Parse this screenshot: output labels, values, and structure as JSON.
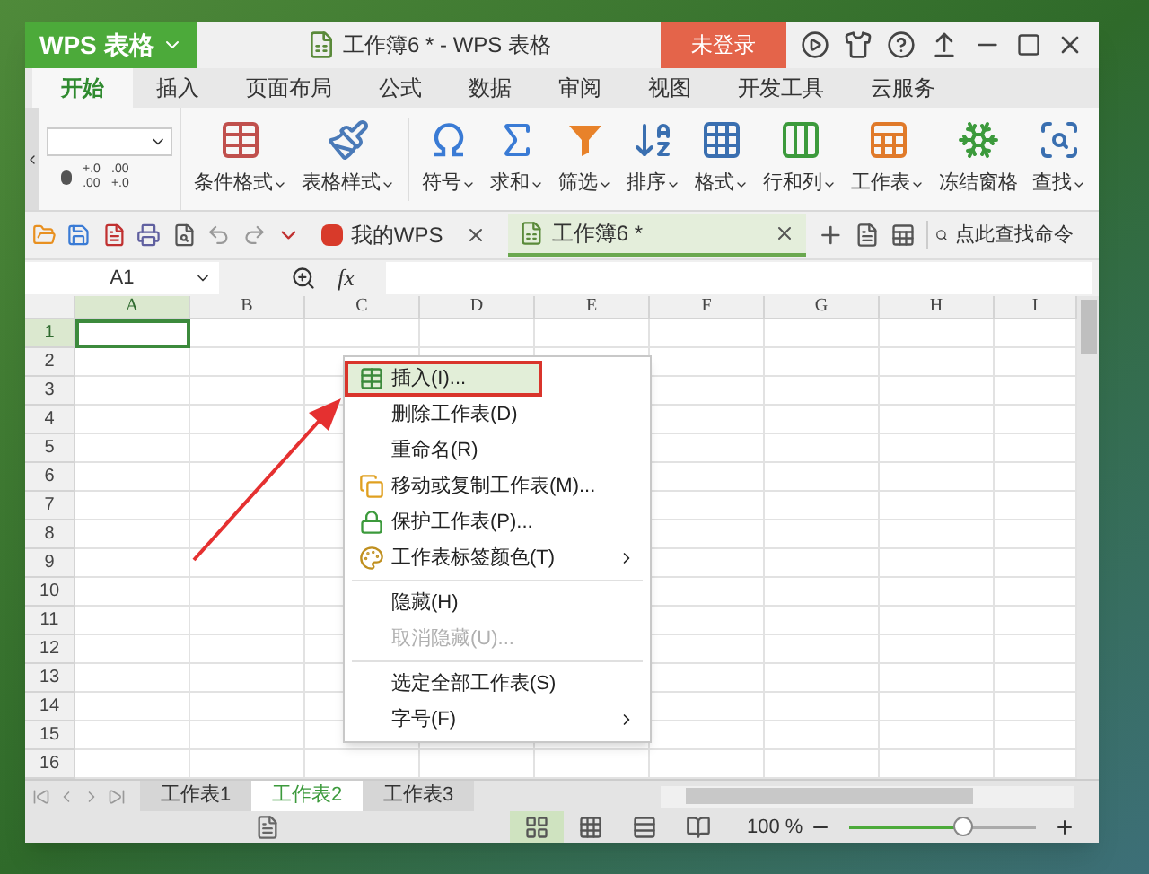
{
  "app_button": {
    "label": "WPS 表格"
  },
  "window": {
    "title": "工作簿6 * - WPS 表格"
  },
  "login_button": {
    "label": "未登录"
  },
  "ribbon_tabs": [
    {
      "label": "开始",
      "selected": true
    },
    {
      "label": "插入",
      "selected": false
    },
    {
      "label": "页面布局",
      "selected": false
    },
    {
      "label": "公式",
      "selected": false
    },
    {
      "label": "数据",
      "selected": false
    },
    {
      "label": "审阅",
      "selected": false
    },
    {
      "label": "视图",
      "selected": false
    },
    {
      "label": "开发工具",
      "selected": false
    },
    {
      "label": "云服务",
      "selected": false
    }
  ],
  "number_format": {
    "decimal_buttons": [
      {
        "lines": [
          "+.0",
          ".00"
        ]
      },
      {
        "lines": [
          ".00",
          "+.0"
        ]
      }
    ]
  },
  "ribbon_buttons": [
    {
      "kind": "conditional",
      "label": "条件格式",
      "dropdown": true
    },
    {
      "kind": "tablestyle",
      "label": "表格样式",
      "dropdown": true
    },
    {
      "kind": "symbol",
      "label": "符号",
      "dropdown": true
    },
    {
      "kind": "sum",
      "label": "求和",
      "dropdown": true
    },
    {
      "kind": "filter",
      "label": "筛选",
      "dropdown": true
    },
    {
      "kind": "sort",
      "label": "排序",
      "dropdown": true
    },
    {
      "kind": "format",
      "label": "格式",
      "dropdown": true
    },
    {
      "kind": "rowcol",
      "label": "行和列",
      "dropdown": true
    },
    {
      "kind": "sheet",
      "label": "工作表",
      "dropdown": true
    },
    {
      "kind": "freeze",
      "label": "冻结窗格",
      "dropdown": false
    },
    {
      "kind": "find",
      "label": "查找",
      "dropdown": true
    }
  ],
  "doc_tabs": [
    {
      "kind": "home",
      "label": "我的WPS",
      "selected": false
    },
    {
      "kind": "workbook",
      "label": "工作簿6 *",
      "selected": true
    }
  ],
  "command_search": {
    "placeholder": "点此查找命令"
  },
  "name_box": {
    "value": "A1"
  },
  "formula_bar": {
    "fx": "fx"
  },
  "columns": [
    {
      "label": "A",
      "selected": true
    },
    {
      "label": "B",
      "selected": false
    },
    {
      "label": "C",
      "selected": false
    },
    {
      "label": "D",
      "selected": false
    },
    {
      "label": "E",
      "selected": false
    },
    {
      "label": "F",
      "selected": false
    },
    {
      "label": "G",
      "selected": false
    },
    {
      "label": "H",
      "selected": false
    },
    {
      "label": "I",
      "selected": false
    }
  ],
  "rows": [
    {
      "label": "1",
      "selected": true
    },
    {
      "label": "2",
      "selected": false
    },
    {
      "label": "3",
      "selected": false
    },
    {
      "label": "4",
      "selected": false
    },
    {
      "label": "5",
      "selected": false
    },
    {
      "label": "6",
      "selected": false
    },
    {
      "label": "7",
      "selected": false
    },
    {
      "label": "8",
      "selected": false
    },
    {
      "label": "9",
      "selected": false
    },
    {
      "label": "10",
      "selected": false
    },
    {
      "label": "11",
      "selected": false
    },
    {
      "label": "12",
      "selected": false
    },
    {
      "label": "13",
      "selected": false
    },
    {
      "label": "14",
      "selected": false
    },
    {
      "label": "15",
      "selected": false
    },
    {
      "label": "16",
      "selected": false
    }
  ],
  "context_menu": {
    "items": [
      {
        "kind": "insert",
        "label": "插入(I)...",
        "disabled": false,
        "submenu": false,
        "highlighted": true
      },
      {
        "kind": "plain",
        "label": "删除工作表(D)",
        "disabled": false,
        "submenu": false,
        "highlighted": false
      },
      {
        "kind": "plain",
        "label": "重命名(R)",
        "disabled": false,
        "submenu": false,
        "highlighted": false
      },
      {
        "kind": "move",
        "label": "移动或复制工作表(M)...",
        "disabled": false,
        "submenu": false,
        "highlighted": false
      },
      {
        "kind": "protect",
        "label": "保护工作表(P)...",
        "disabled": false,
        "submenu": false,
        "highlighted": false
      },
      {
        "kind": "color",
        "label": "工作表标签颜色(T)",
        "disabled": false,
        "submenu": true,
        "highlighted": false
      },
      {
        "kind": "divider"
      },
      {
        "kind": "plain",
        "label": "隐藏(H)",
        "disabled": false,
        "submenu": false,
        "highlighted": false
      },
      {
        "kind": "plain",
        "label": "取消隐藏(U)...",
        "disabled": true,
        "submenu": false,
        "highlighted": false
      },
      {
        "kind": "divider"
      },
      {
        "kind": "plain",
        "label": "选定全部工作表(S)",
        "disabled": false,
        "submenu": false,
        "highlighted": false
      },
      {
        "kind": "plain",
        "label": "字号(F)",
        "disabled": false,
        "submenu": true,
        "highlighted": false
      }
    ]
  },
  "sheet_tabs": [
    {
      "label": "工作表1",
      "selected": false
    },
    {
      "label": "工作表2",
      "selected": true
    },
    {
      "label": "工作表3",
      "selected": false
    }
  ],
  "status_bar": {
    "views": [
      {
        "kind": "normal",
        "selected": true
      },
      {
        "kind": "pagebreak",
        "selected": false
      },
      {
        "kind": "layout",
        "selected": false
      },
      {
        "kind": "reading",
        "selected": false
      }
    ],
    "zoom": "100 %",
    "zoom_slider": {
      "level": 0.6
    }
  }
}
